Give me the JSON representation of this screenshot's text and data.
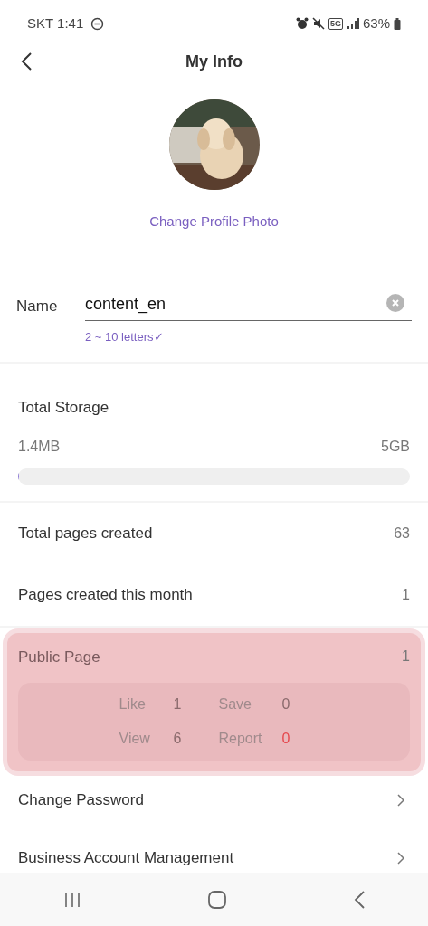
{
  "status_bar": {
    "carrier_time": "SKT 1:41",
    "network": "5G",
    "battery": "63%"
  },
  "header": {
    "title": "My Info"
  },
  "profile": {
    "change_link": "Change Profile Photo"
  },
  "name_field": {
    "label": "Name",
    "value": "content_en",
    "hint": "2 ~ 10 letters✓"
  },
  "storage": {
    "title": "Total Storage",
    "used": "1.4MB",
    "total": "5GB",
    "level": 0.0003
  },
  "counts": [
    {
      "label": "Total pages created",
      "value": "63"
    },
    {
      "label": "Pages created this month",
      "value": "1"
    }
  ],
  "public_page": {
    "label": "Public Page",
    "value": "1",
    "highlighted": true,
    "stats": [
      {
        "label": "Like",
        "value": "1",
        "color": "#8a6a6c"
      },
      {
        "label": "Save",
        "value": "0",
        "color": "#8a6a6c"
      },
      {
        "label": "View",
        "value": "6",
        "color": "#8a6a6c"
      },
      {
        "label": "Report",
        "value": "0",
        "color": "#e5484d"
      }
    ]
  },
  "menu": [
    {
      "label": "Change Password"
    },
    {
      "label": "Business Account Management"
    }
  ]
}
